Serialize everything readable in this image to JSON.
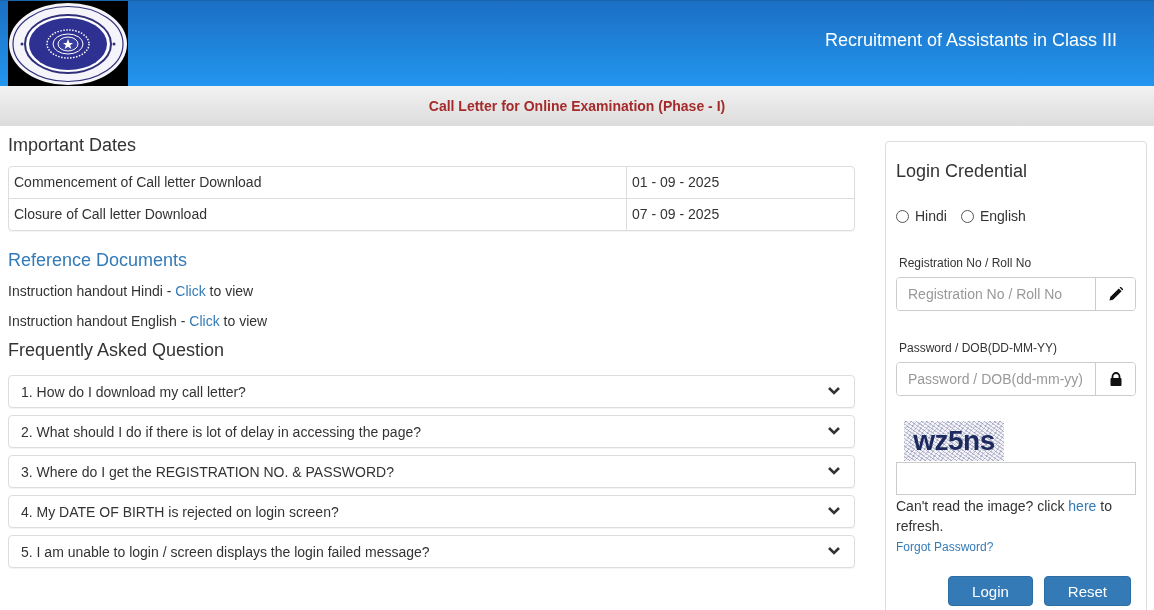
{
  "header": {
    "title": "Recruitment of Assistants in Class III"
  },
  "subheader": {
    "title": "Call Letter for Online Examination (Phase - I)"
  },
  "important_dates": {
    "title": "Important Dates",
    "rows": [
      {
        "event": "Commencement of Call letter Download",
        "date": "01 - 09 - 2025"
      },
      {
        "event": "Closure of Call letter Download",
        "date": "07 - 09 - 2025"
      }
    ]
  },
  "reference_documents": {
    "title": "Reference Documents",
    "items": [
      {
        "before": "Instruction handout Hindi - ",
        "link": "Click",
        "after": " to view"
      },
      {
        "before": "Instruction handout English - ",
        "link": "Click",
        "after": " to view"
      }
    ]
  },
  "faq": {
    "title": "Frequently Asked Question",
    "items": [
      {
        "question": "1. How do I download my call letter?",
        "expanded": false
      },
      {
        "question": "2. What should I do if there is lot of delay in accessing the page?",
        "expanded": false
      },
      {
        "question": "3. Where do I get the REGISTRATION NO. & PASSWORD?",
        "expanded": false
      },
      {
        "question": "4. My DATE OF BIRTH is rejected on login screen?",
        "expanded": false
      },
      {
        "question": "5. I am unable to login / screen displays the login failed message?",
        "expanded": false
      }
    ]
  },
  "login": {
    "title": "Login Credential",
    "languages": [
      {
        "label": "Hindi",
        "selected": false
      },
      {
        "label": "English",
        "selected": false
      }
    ],
    "fields": [
      {
        "label": "Registration No / Roll No",
        "placeholder": "Registration No / Roll No",
        "kind": "text"
      },
      {
        "label": "Password / DOB(DD-MM-YY)",
        "placeholder": "Password / DOB(dd-mm-yy)",
        "kind": "password"
      }
    ],
    "captcha": {
      "text": "wz5ns"
    },
    "refresh_note": {
      "before": "Can't read the image? click ",
      "link": "here",
      "after": " to refresh."
    },
    "forgot_link": "Forgot Password?",
    "buttons": [
      "Login",
      "Reset"
    ]
  }
}
